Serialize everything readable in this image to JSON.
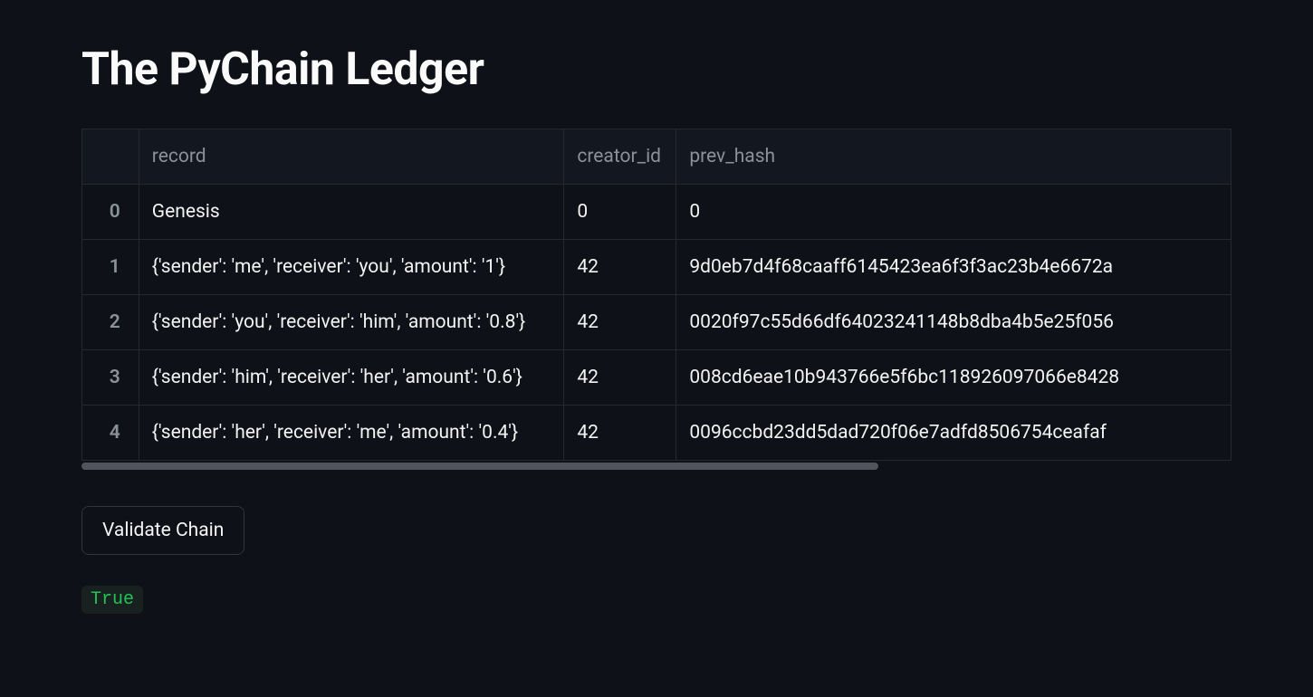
{
  "title": "The PyChain Ledger",
  "columns": [
    "record",
    "creator_id",
    "prev_hash"
  ],
  "rows": [
    {
      "idx": "0",
      "record": "Genesis",
      "creator_id": "0",
      "prev_hash": "0"
    },
    {
      "idx": "1",
      "record": "{'sender': 'me', 'receiver': 'you', 'amount': '1'}",
      "creator_id": "42",
      "prev_hash": "9d0eb7d4f68caaff6145423ea6f3f3ac23b4e6672a"
    },
    {
      "idx": "2",
      "record": "{'sender': 'you', 'receiver': 'him', 'amount': '0.8'}",
      "creator_id": "42",
      "prev_hash": "0020f97c55d66df64023241148b8dba4b5e25f056"
    },
    {
      "idx": "3",
      "record": "{'sender': 'him', 'receiver': 'her', 'amount': '0.6'}",
      "creator_id": "42",
      "prev_hash": "008cd6eae10b943766e5f6bc118926097066e8428"
    },
    {
      "idx": "4",
      "record": "{'sender': 'her', 'receiver': 'me', 'amount': '0.4'}",
      "creator_id": "42",
      "prev_hash": "0096ccbd23dd5dad720f06e7adfd8506754ceafaf"
    }
  ],
  "validate_button_label": "Validate Chain",
  "validation_result": "True"
}
